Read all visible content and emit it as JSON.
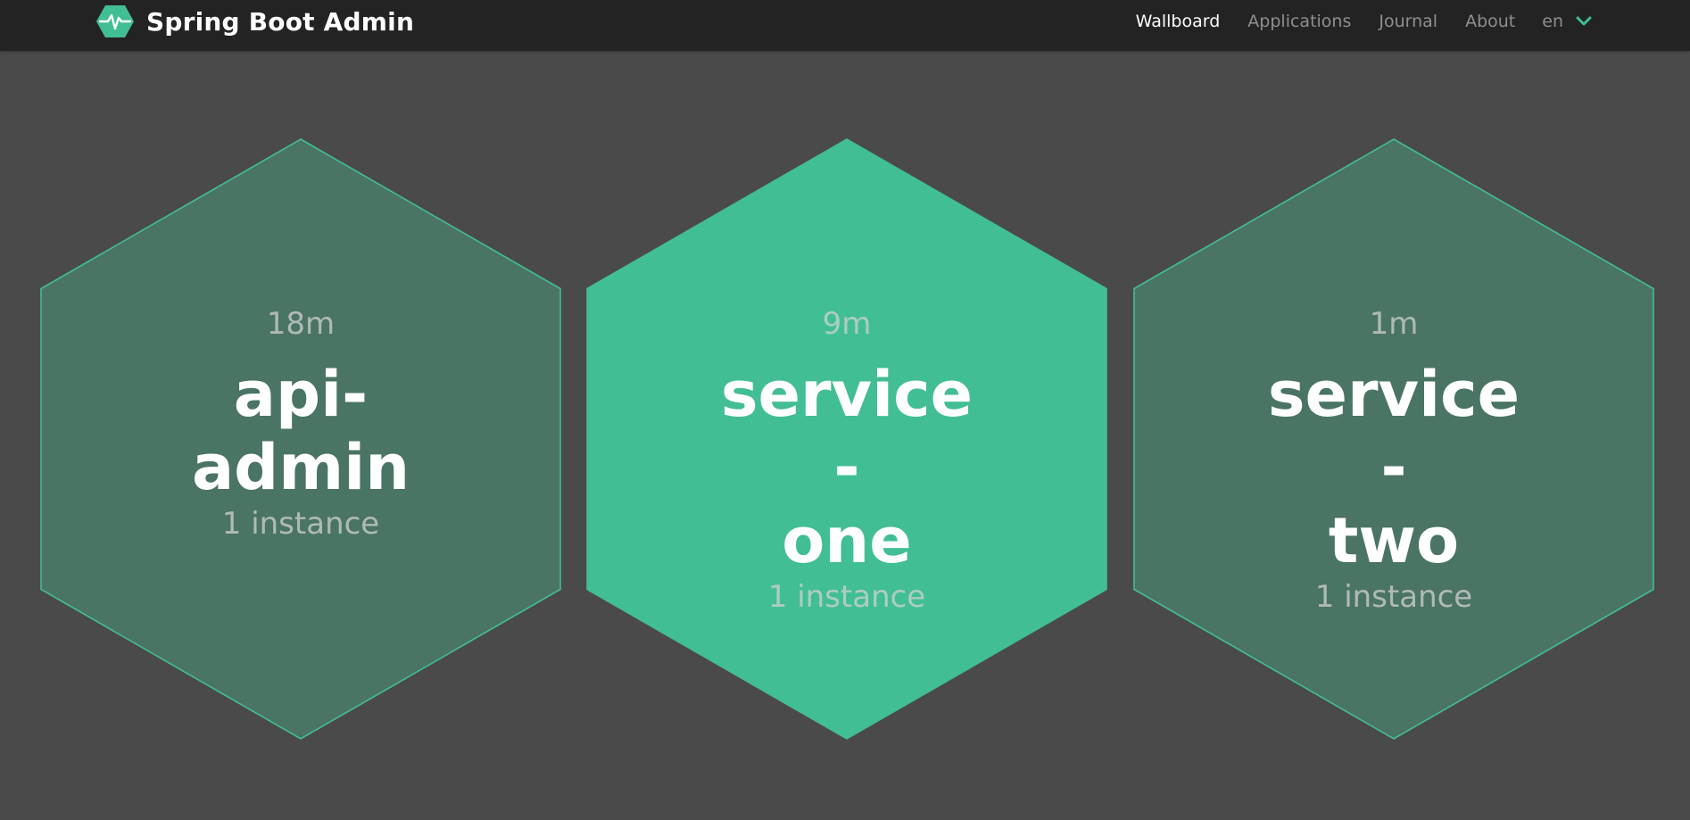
{
  "navbar": {
    "brand_title": "Spring Boot Admin",
    "logo_icon": "heartbeat-hexagon-icon",
    "items": [
      {
        "label": "Wallboard",
        "active": true
      },
      {
        "label": "Applications",
        "active": false
      },
      {
        "label": "Journal",
        "active": false
      },
      {
        "label": "About",
        "active": false
      }
    ],
    "language": "en"
  },
  "colors": {
    "accent": "#42be94",
    "tile_dim_fill": "#4a7463",
    "background": "#4a4a4a",
    "navbar": "#232323"
  },
  "applications": [
    {
      "name_line1": "api-",
      "name_line2": "admin",
      "uptime": "18m",
      "instances": "1 instance",
      "highlighted": false
    },
    {
      "name_line1": "service-",
      "name_line2": "one",
      "uptime": "9m",
      "instances": "1 instance",
      "highlighted": true
    },
    {
      "name_line1": "service-",
      "name_line2": "two",
      "uptime": "1m",
      "instances": "1 instance",
      "highlighted": false
    }
  ]
}
